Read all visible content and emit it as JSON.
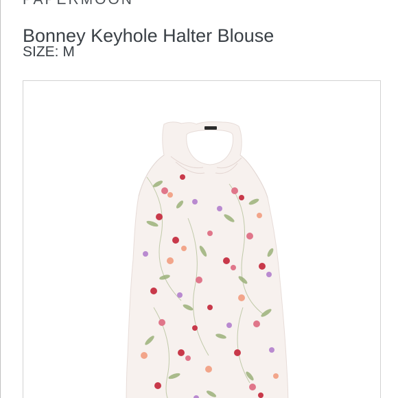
{
  "product": {
    "brand": "PAPERMOON",
    "title": "Bonney Keyhole Halter Blouse",
    "size_label": "SIZE: M"
  },
  "image": {
    "subject": "blouse-photo",
    "colors": {
      "fabric": "#f7f1ee",
      "flower_pink": "#e0768a",
      "flower_red": "#c8394a",
      "flower_lilac": "#b98ad0",
      "flower_peach": "#f2a58a",
      "leaf": "#8fa86a"
    }
  }
}
